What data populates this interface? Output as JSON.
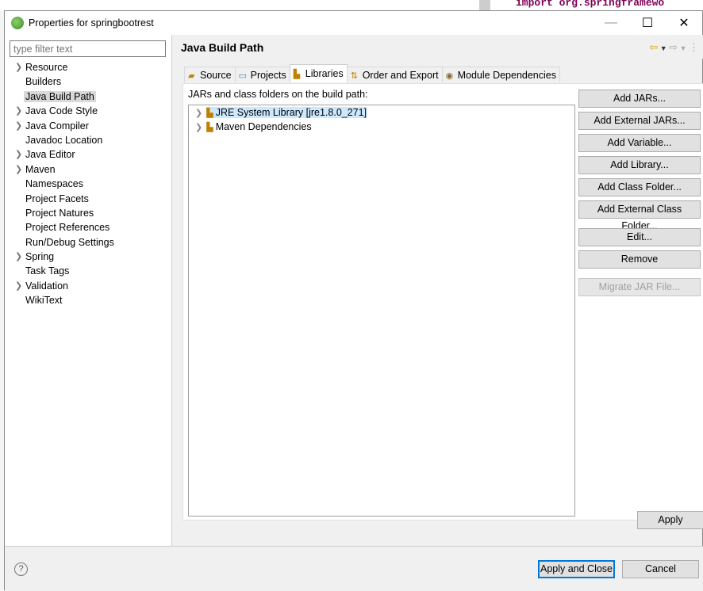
{
  "background": {
    "code_fragment": "import org.springframewo"
  },
  "window": {
    "title": "Properties for springbootrest",
    "minimize": "—",
    "maximize": "☐",
    "close": "✕"
  },
  "filter": {
    "placeholder": "type filter text"
  },
  "tree": [
    {
      "label": "Resource",
      "expandable": true
    },
    {
      "label": "Builders",
      "expandable": false
    },
    {
      "label": "Java Build Path",
      "expandable": false,
      "selected": true
    },
    {
      "label": "Java Code Style",
      "expandable": true
    },
    {
      "label": "Java Compiler",
      "expandable": true
    },
    {
      "label": "Javadoc Location",
      "expandable": false
    },
    {
      "label": "Java Editor",
      "expandable": true
    },
    {
      "label": "Maven",
      "expandable": true
    },
    {
      "label": "Namespaces",
      "expandable": false
    },
    {
      "label": "Project Facets",
      "expandable": false
    },
    {
      "label": "Project Natures",
      "expandable": false
    },
    {
      "label": "Project References",
      "expandable": false
    },
    {
      "label": "Run/Debug Settings",
      "expandable": false
    },
    {
      "label": "Spring",
      "expandable": true
    },
    {
      "label": "Task Tags",
      "expandable": false
    },
    {
      "label": "Validation",
      "expandable": true
    },
    {
      "label": "WikiText",
      "expandable": false
    }
  ],
  "page": {
    "title": "Java Build Path"
  },
  "tabs": [
    {
      "label": "Source",
      "icon": "source-folder-icon"
    },
    {
      "label": "Projects",
      "icon": "projects-folder-icon"
    },
    {
      "label": "Libraries",
      "icon": "libraries-icon",
      "active": true
    },
    {
      "label": "Order and Export",
      "icon": "order-export-icon"
    },
    {
      "label": "Module Dependencies",
      "icon": "module-icon"
    }
  ],
  "libraries": {
    "label": "JARs and class folders on the build path:",
    "items": [
      {
        "label": "JRE System Library [jre1.8.0_271]",
        "selected": true
      },
      {
        "label": "Maven Dependencies",
        "selected": false
      }
    ],
    "buttons": [
      {
        "label": "Add JARs...",
        "enabled": true
      },
      {
        "label": "Add External JARs...",
        "enabled": true
      },
      {
        "label": "Add Variable...",
        "enabled": true
      },
      {
        "label": "Add Library...",
        "enabled": true
      },
      {
        "label": "Add Class Folder...",
        "enabled": true
      },
      {
        "label": "Add External Class Folder...",
        "enabled": true
      },
      {
        "label": "Edit...",
        "enabled": true
      },
      {
        "label": "Remove",
        "enabled": true
      },
      {
        "label": "Migrate JAR File...",
        "enabled": false
      }
    ]
  },
  "apply": "Apply",
  "footer": {
    "help": "?",
    "apply_close": "Apply and Close",
    "cancel": "Cancel"
  }
}
